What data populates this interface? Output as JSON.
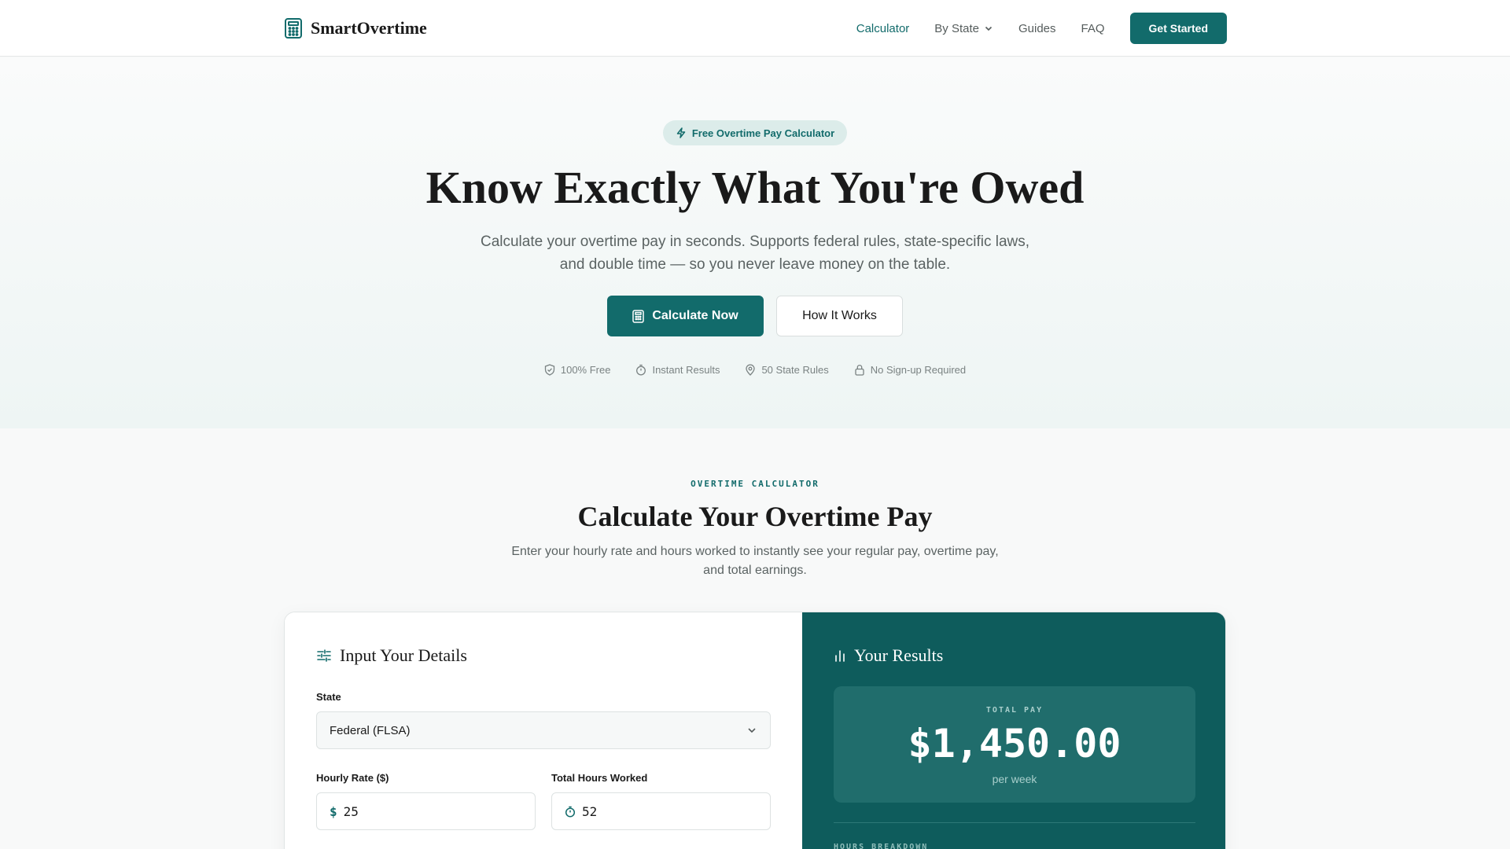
{
  "header": {
    "brand": "SmartOvertime",
    "nav": [
      {
        "label": "Calculator",
        "active": true
      },
      {
        "label": "By State",
        "active": false,
        "has_dropdown": true
      },
      {
        "label": "Guides",
        "active": false
      },
      {
        "label": "FAQ",
        "active": false
      }
    ],
    "cta_label": "Get Started"
  },
  "hero": {
    "badge": "Free Overtime Pay Calculator",
    "title": "Know Exactly What You're Owed",
    "subtitle": "Calculate your overtime pay in seconds. Supports federal rules, state-specific laws, and double time — so you never leave money on the table.",
    "primary_cta": "Calculate Now",
    "secondary_cta": "How It Works",
    "trust": [
      {
        "icon": "shield-icon",
        "label": "100% Free"
      },
      {
        "icon": "timer-icon",
        "label": "Instant Results"
      },
      {
        "icon": "map-pin-icon",
        "label": "50 State Rules"
      },
      {
        "icon": "lock-icon",
        "label": "No Sign-up Required"
      }
    ]
  },
  "calculator": {
    "eyebrow": "OVERTIME CALCULATOR",
    "title": "Calculate Your Overtime Pay",
    "subtitle": "Enter your hourly rate and hours worked to instantly see your regular pay, overtime pay, and total earnings.",
    "inputs": {
      "title": "Input Your Details",
      "state_label": "State",
      "state_value": "Federal (FLSA)",
      "rate_label": "Hourly Rate ($)",
      "rate_prefix": "$",
      "rate_value": "25",
      "hours_label": "Total Hours Worked",
      "hours_value": "52"
    },
    "results": {
      "title": "Your Results",
      "total_label": "TOTAL PAY",
      "total_value": "$1,450.00",
      "period": "per week",
      "breakdown_label": "HOURS BREAKDOWN"
    }
  },
  "colors": {
    "accent": "#126b6b",
    "results_bg": "#0e5c5c",
    "results_box": "#206d6c"
  }
}
